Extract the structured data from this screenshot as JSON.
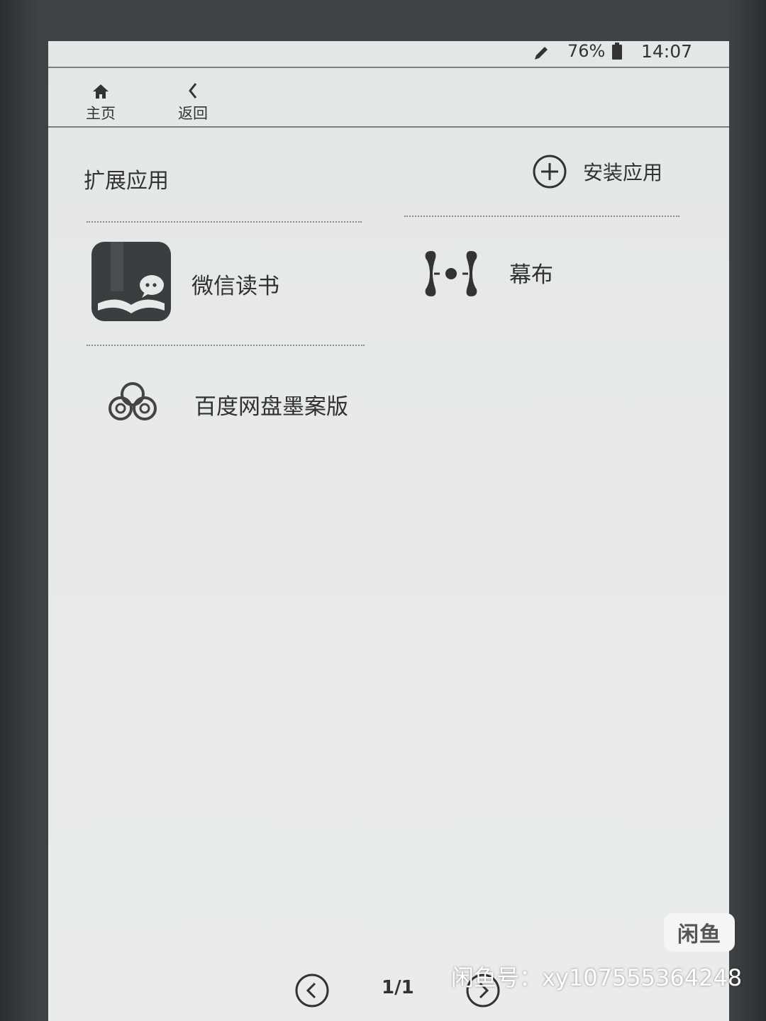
{
  "status_bar": {
    "pen_icon": "pencil-icon",
    "battery_percent": "76%",
    "battery_icon": "battery-icon",
    "time": "14:07"
  },
  "nav": {
    "home": {
      "icon": "home-icon",
      "label": "主页"
    },
    "back": {
      "icon": "chevron-left-icon",
      "label": "返回"
    }
  },
  "section": {
    "title": "扩展应用",
    "install_icon": "plus-circle-icon",
    "install_label": "安装应用"
  },
  "apps": [
    {
      "name": "微信读书",
      "icon": "wechat-read-icon"
    },
    {
      "name": "幕布",
      "icon": "mubu-icon"
    },
    {
      "name": "百度网盘墨案版",
      "icon": "baidu-netdisk-icon"
    }
  ],
  "pager": {
    "prev_icon": "chevron-left-circle-icon",
    "page": "1/1",
    "next_icon": "chevron-right-circle-icon"
  },
  "watermark": {
    "logo": "闲鱼",
    "text": "闲鱼号：xy107555364248"
  },
  "colors": {
    "screen": "#e6e9e7",
    "ink": "#2a2c2e",
    "bezel": "#3f4346"
  }
}
